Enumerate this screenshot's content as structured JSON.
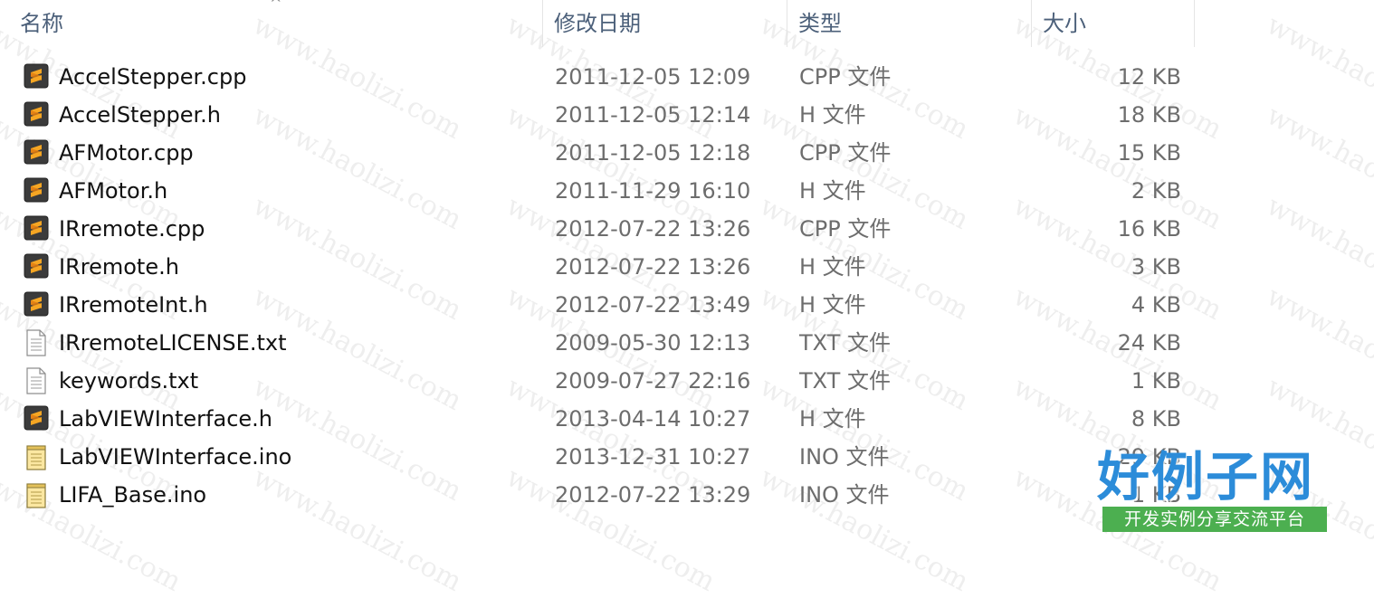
{
  "header": {
    "columns": {
      "name": "名称",
      "date": "修改日期",
      "type": "类型",
      "size": "大小"
    },
    "sort_indicator": "^"
  },
  "files": [
    {
      "name": "AccelStepper.cpp",
      "date": "2011-12-05 12:09",
      "type": "CPP 文件",
      "size": "12 KB",
      "icon": "sublime-icon"
    },
    {
      "name": "AccelStepper.h",
      "date": "2011-12-05 12:14",
      "type": "H 文件",
      "size": "18 KB",
      "icon": "sublime-icon"
    },
    {
      "name": "AFMotor.cpp",
      "date": "2011-12-05 12:18",
      "type": "CPP 文件",
      "size": "15 KB",
      "icon": "sublime-icon"
    },
    {
      "name": "AFMotor.h",
      "date": "2011-11-29 16:10",
      "type": "H 文件",
      "size": "2 KB",
      "icon": "sublime-icon"
    },
    {
      "name": "IRremote.cpp",
      "date": "2012-07-22 13:26",
      "type": "CPP 文件",
      "size": "16 KB",
      "icon": "sublime-icon"
    },
    {
      "name": "IRremote.h",
      "date": "2012-07-22 13:26",
      "type": "H 文件",
      "size": "3 KB",
      "icon": "sublime-icon"
    },
    {
      "name": "IRremoteInt.h",
      "date": "2012-07-22 13:49",
      "type": "H 文件",
      "size": "4 KB",
      "icon": "sublime-icon"
    },
    {
      "name": "IRremoteLICENSE.txt",
      "date": "2009-05-30 12:13",
      "type": "TXT 文件",
      "size": "24 KB",
      "icon": "text-file-icon"
    },
    {
      "name": "keywords.txt",
      "date": "2009-07-27 22:16",
      "type": "TXT 文件",
      "size": "1 KB",
      "icon": "text-file-icon"
    },
    {
      "name": "LabVIEWInterface.h",
      "date": "2013-04-14 10:27",
      "type": "H 文件",
      "size": "8 KB",
      "icon": "sublime-icon"
    },
    {
      "name": "LabVIEWInterface.ino",
      "date": "2013-12-31 10:27",
      "type": "INO 文件",
      "size": "29 KB",
      "icon": "notepad-icon"
    },
    {
      "name": "LIFA_Base.ino",
      "date": "2012-07-22 13:29",
      "type": "INO 文件",
      "size": "1 KB",
      "icon": "notepad-icon"
    }
  ],
  "watermark": {
    "text": "www.haolizi.com"
  },
  "logo": {
    "title": "好例子网",
    "tagline": "开发实例分享交流平台",
    "colors": {
      "title": "#2c8cd9",
      "bar": "#4caf50"
    }
  },
  "colors": {
    "header_text": "#4c607a",
    "secondary_text": "#6d6d6d",
    "sublime_orange": "#f08c1a"
  }
}
